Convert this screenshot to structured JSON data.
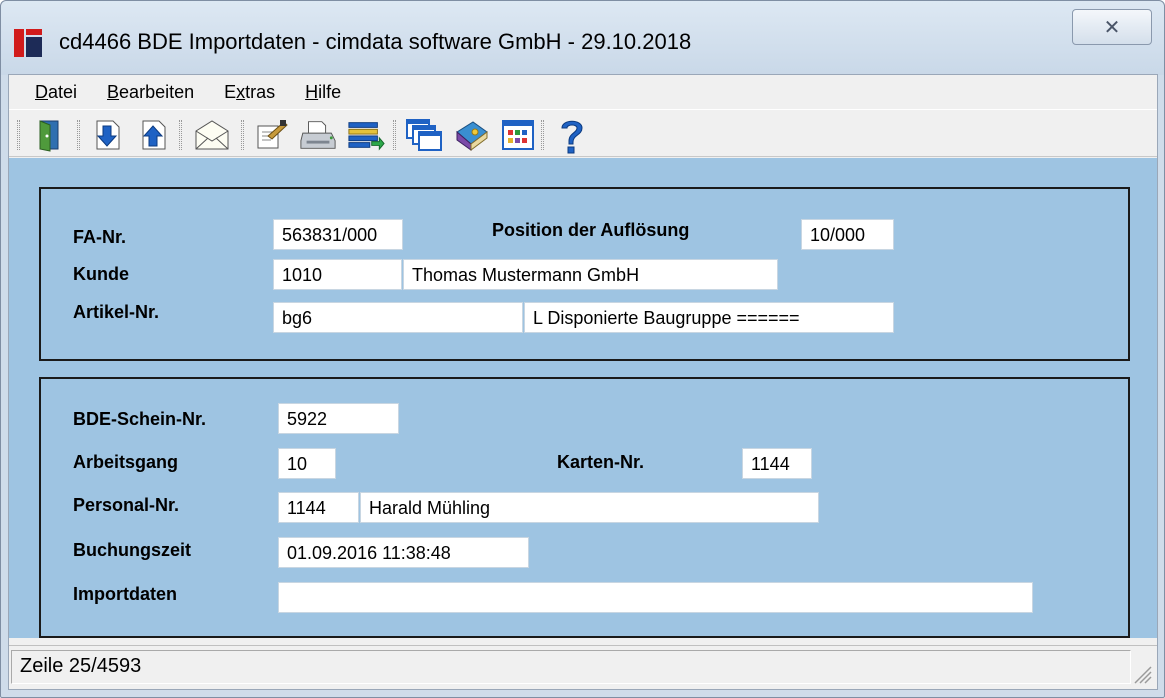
{
  "window": {
    "title": "cd4466 BDE Importdaten - cimdata software GmbH - 29.10.2018",
    "close_label": "✕"
  },
  "menu": [
    {
      "label": "Datei",
      "mnemonic": "D"
    },
    {
      "label": "Bearbeiten",
      "mnemonic": "B"
    },
    {
      "label": "Extras",
      "mnemonic": "x"
    },
    {
      "label": "Hilfe",
      "mnemonic": "H"
    }
  ],
  "toolbar": {
    "icons": [
      "exit-door-icon",
      "import-down-icon",
      "export-up-icon",
      "mail-icon",
      "edit-note-icon",
      "printer-icon",
      "list-transfer-icon",
      "windows-cascade-icon",
      "book-icon",
      "grid-table-icon",
      "help-icon"
    ]
  },
  "header_group": {
    "fa_nr_label": "FA-Nr.",
    "fa_nr_value": "563831/000",
    "position_label": "Position der Auflösung",
    "position_value": "10/000",
    "kunde_label": "Kunde",
    "kunde_nr": "1010",
    "kunde_name": "Thomas Mustermann GmbH",
    "artikel_label": "Artikel-Nr.",
    "artikel_nr": "bg6",
    "artikel_desc": "L Disponierte Baugruppe ======"
  },
  "detail_group": {
    "bde_label": "BDE-Schein-Nr.",
    "bde_value": "5922",
    "arbeitsgang_label": "Arbeitsgang",
    "arbeitsgang_value": "10",
    "karten_label": "Karten-Nr.",
    "karten_value": "1144",
    "personal_label": "Personal-Nr.",
    "personal_nr": "1144",
    "personal_name": "Harald Mühling",
    "buchungszeit_label": "Buchungszeit",
    "buchungszeit_value": "01.09.2016 11:38:48",
    "importdaten_label": "Importdaten",
    "importdaten_value": ""
  },
  "status": {
    "text": "Zeile 25/4593"
  },
  "colors": {
    "panel_background": "#9ec4e2",
    "logo_red": "#d11b1b",
    "logo_navy": "#1d2b57"
  }
}
